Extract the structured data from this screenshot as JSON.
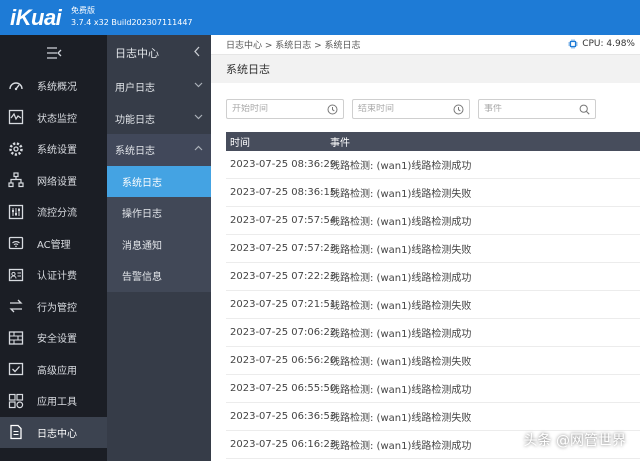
{
  "header": {
    "logo": "iKuai",
    "edition": "免费版",
    "version": "3.7.4 x32 Build202307111447"
  },
  "sidebar": {
    "items": [
      {
        "label": "系统概况",
        "icon": "dashboard-icon"
      },
      {
        "label": "状态监控",
        "icon": "monitor-icon"
      },
      {
        "label": "系统设置",
        "icon": "gear-icon"
      },
      {
        "label": "网络设置",
        "icon": "network-icon"
      },
      {
        "label": "流控分流",
        "icon": "slider-icon"
      },
      {
        "label": "AC管理",
        "icon": "wifi-icon"
      },
      {
        "label": "认证计费",
        "icon": "id-card-icon"
      },
      {
        "label": "行为管控",
        "icon": "arrows-icon"
      },
      {
        "label": "安全设置",
        "icon": "firewall-icon"
      },
      {
        "label": "高级应用",
        "icon": "checklist-icon"
      },
      {
        "label": "应用工具",
        "icon": "apps-icon"
      },
      {
        "label": "日志中心",
        "icon": "log-icon"
      }
    ]
  },
  "submenu": {
    "title": "日志中心",
    "groups": [
      {
        "label": "用户日志"
      },
      {
        "label": "功能日志"
      },
      {
        "label": "系统日志"
      }
    ],
    "children": [
      {
        "label": "系统日志"
      },
      {
        "label": "操作日志"
      },
      {
        "label": "消息通知"
      },
      {
        "label": "告警信息"
      }
    ]
  },
  "breadcrumb": "日志中心 > 系统日志 > 系统日志",
  "cpu": "CPU: 4.98%",
  "page_title": "系统日志",
  "filters": {
    "start_placeholder": "开始时间",
    "end_placeholder": "结束时间",
    "event_placeholder": "事件"
  },
  "table": {
    "columns": [
      "时间",
      "事件"
    ],
    "rows": [
      [
        "2023-07-25 08:36:29",
        "线路检测: (wan1)线路检测成功"
      ],
      [
        "2023-07-25 08:36:15",
        "线路检测: (wan1)线路检测失败"
      ],
      [
        "2023-07-25 07:57:54",
        "线路检测: (wan1)线路检测成功"
      ],
      [
        "2023-07-25 07:57:23",
        "线路检测: (wan1)线路检测失败"
      ],
      [
        "2023-07-25 07:22:23",
        "线路检测: (wan1)线路检测成功"
      ],
      [
        "2023-07-25 07:21:51",
        "线路检测: (wan1)线路检测失败"
      ],
      [
        "2023-07-25 07:06:22",
        "线路检测: (wan1)线路检测成功"
      ],
      [
        "2023-07-25 06:56:20",
        "线路检测: (wan1)线路检测失败"
      ],
      [
        "2023-07-25 06:55:50",
        "线路检测: (wan1)线路检测成功"
      ],
      [
        "2023-07-25 06:36:53",
        "线路检测: (wan1)线路检测失败"
      ],
      [
        "2023-07-25 06:16:23",
        "线路检测: (wan1)线路检测成功"
      ]
    ]
  },
  "watermark": "头条 @网管世界",
  "colors": {
    "header": "#1e7bd6",
    "sidebar": "#1b1e25",
    "submenu": "#363c48",
    "active_child": "#44a3e3",
    "table_header": "#474d5c"
  }
}
